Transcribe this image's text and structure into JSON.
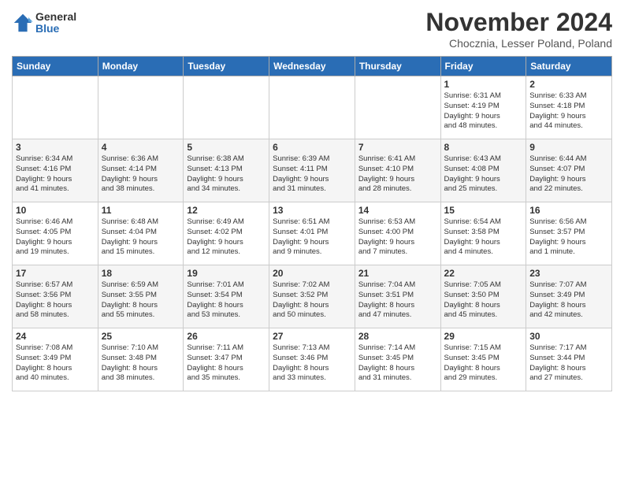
{
  "logo": {
    "general": "General",
    "blue": "Blue"
  },
  "title": "November 2024",
  "subtitle": "Chocznia, Lesser Poland, Poland",
  "headers": [
    "Sunday",
    "Monday",
    "Tuesday",
    "Wednesday",
    "Thursday",
    "Friday",
    "Saturday"
  ],
  "weeks": [
    [
      {
        "day": "",
        "info": ""
      },
      {
        "day": "",
        "info": ""
      },
      {
        "day": "",
        "info": ""
      },
      {
        "day": "",
        "info": ""
      },
      {
        "day": "",
        "info": ""
      },
      {
        "day": "1",
        "info": "Sunrise: 6:31 AM\nSunset: 4:19 PM\nDaylight: 9 hours\nand 48 minutes."
      },
      {
        "day": "2",
        "info": "Sunrise: 6:33 AM\nSunset: 4:18 PM\nDaylight: 9 hours\nand 44 minutes."
      }
    ],
    [
      {
        "day": "3",
        "info": "Sunrise: 6:34 AM\nSunset: 4:16 PM\nDaylight: 9 hours\nand 41 minutes."
      },
      {
        "day": "4",
        "info": "Sunrise: 6:36 AM\nSunset: 4:14 PM\nDaylight: 9 hours\nand 38 minutes."
      },
      {
        "day": "5",
        "info": "Sunrise: 6:38 AM\nSunset: 4:13 PM\nDaylight: 9 hours\nand 34 minutes."
      },
      {
        "day": "6",
        "info": "Sunrise: 6:39 AM\nSunset: 4:11 PM\nDaylight: 9 hours\nand 31 minutes."
      },
      {
        "day": "7",
        "info": "Sunrise: 6:41 AM\nSunset: 4:10 PM\nDaylight: 9 hours\nand 28 minutes."
      },
      {
        "day": "8",
        "info": "Sunrise: 6:43 AM\nSunset: 4:08 PM\nDaylight: 9 hours\nand 25 minutes."
      },
      {
        "day": "9",
        "info": "Sunrise: 6:44 AM\nSunset: 4:07 PM\nDaylight: 9 hours\nand 22 minutes."
      }
    ],
    [
      {
        "day": "10",
        "info": "Sunrise: 6:46 AM\nSunset: 4:05 PM\nDaylight: 9 hours\nand 19 minutes."
      },
      {
        "day": "11",
        "info": "Sunrise: 6:48 AM\nSunset: 4:04 PM\nDaylight: 9 hours\nand 15 minutes."
      },
      {
        "day": "12",
        "info": "Sunrise: 6:49 AM\nSunset: 4:02 PM\nDaylight: 9 hours\nand 12 minutes."
      },
      {
        "day": "13",
        "info": "Sunrise: 6:51 AM\nSunset: 4:01 PM\nDaylight: 9 hours\nand 9 minutes."
      },
      {
        "day": "14",
        "info": "Sunrise: 6:53 AM\nSunset: 4:00 PM\nDaylight: 9 hours\nand 7 minutes."
      },
      {
        "day": "15",
        "info": "Sunrise: 6:54 AM\nSunset: 3:58 PM\nDaylight: 9 hours\nand 4 minutes."
      },
      {
        "day": "16",
        "info": "Sunrise: 6:56 AM\nSunset: 3:57 PM\nDaylight: 9 hours\nand 1 minute."
      }
    ],
    [
      {
        "day": "17",
        "info": "Sunrise: 6:57 AM\nSunset: 3:56 PM\nDaylight: 8 hours\nand 58 minutes."
      },
      {
        "day": "18",
        "info": "Sunrise: 6:59 AM\nSunset: 3:55 PM\nDaylight: 8 hours\nand 55 minutes."
      },
      {
        "day": "19",
        "info": "Sunrise: 7:01 AM\nSunset: 3:54 PM\nDaylight: 8 hours\nand 53 minutes."
      },
      {
        "day": "20",
        "info": "Sunrise: 7:02 AM\nSunset: 3:52 PM\nDaylight: 8 hours\nand 50 minutes."
      },
      {
        "day": "21",
        "info": "Sunrise: 7:04 AM\nSunset: 3:51 PM\nDaylight: 8 hours\nand 47 minutes."
      },
      {
        "day": "22",
        "info": "Sunrise: 7:05 AM\nSunset: 3:50 PM\nDaylight: 8 hours\nand 45 minutes."
      },
      {
        "day": "23",
        "info": "Sunrise: 7:07 AM\nSunset: 3:49 PM\nDaylight: 8 hours\nand 42 minutes."
      }
    ],
    [
      {
        "day": "24",
        "info": "Sunrise: 7:08 AM\nSunset: 3:49 PM\nDaylight: 8 hours\nand 40 minutes."
      },
      {
        "day": "25",
        "info": "Sunrise: 7:10 AM\nSunset: 3:48 PM\nDaylight: 8 hours\nand 38 minutes."
      },
      {
        "day": "26",
        "info": "Sunrise: 7:11 AM\nSunset: 3:47 PM\nDaylight: 8 hours\nand 35 minutes."
      },
      {
        "day": "27",
        "info": "Sunrise: 7:13 AM\nSunset: 3:46 PM\nDaylight: 8 hours\nand 33 minutes."
      },
      {
        "day": "28",
        "info": "Sunrise: 7:14 AM\nSunset: 3:45 PM\nDaylight: 8 hours\nand 31 minutes."
      },
      {
        "day": "29",
        "info": "Sunrise: 7:15 AM\nSunset: 3:45 PM\nDaylight: 8 hours\nand 29 minutes."
      },
      {
        "day": "30",
        "info": "Sunrise: 7:17 AM\nSunset: 3:44 PM\nDaylight: 8 hours\nand 27 minutes."
      }
    ]
  ]
}
